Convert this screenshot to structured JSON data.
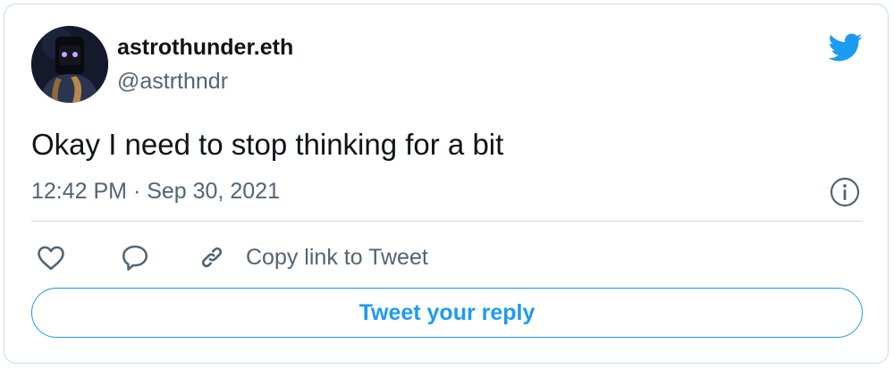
{
  "author": {
    "display_name": "astrothunder.eth",
    "handle": "@astrthndr",
    "avatar_icon": "hooded-figure-glowing-eyes-avatar"
  },
  "tweet": {
    "text": "Okay I need to stop thinking for a bit",
    "timestamp": "12:42 PM · Sep 30, 2021"
  },
  "actions": {
    "like_icon": "heart-icon",
    "reply_icon": "speech-bubble-icon",
    "copy_link_icon": "link-icon",
    "copy_link_label": "Copy link to Tweet"
  },
  "reply_button": {
    "label": "Tweet your reply"
  },
  "colors": {
    "brand": "#1d9bf0",
    "text": "#0f1419",
    "secondary_text": "#536471",
    "border": "#cfd9de"
  }
}
